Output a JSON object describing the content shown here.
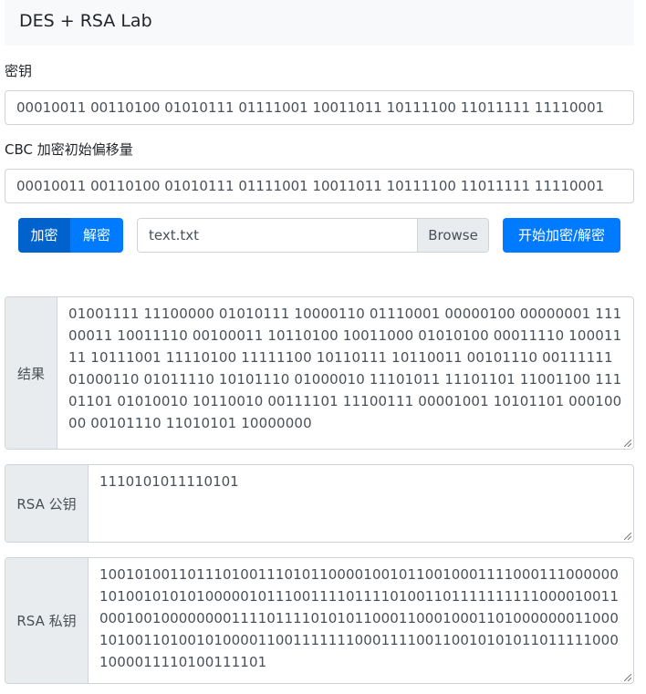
{
  "navbar": {
    "title": "DES + RSA Lab"
  },
  "key": {
    "label": "密钥",
    "value": "00010011 00110100 01010111 01111001 10011011 10111100 11011111 11110001"
  },
  "iv": {
    "label": "CBC 加密初始偏移量",
    "value": "00010011 00110100 01010111 01111001 10011011 10111100 11011111 11110001"
  },
  "mode": {
    "encrypt_label": "加密",
    "decrypt_label": "解密",
    "selected": "加密"
  },
  "file": {
    "name": "text.txt",
    "browse_label": "Browse"
  },
  "start_button": {
    "label": "开始加密/解密"
  },
  "result": {
    "label": "结果",
    "value": "01001111 11100000 01010111 10000110 01110001 00000100 00000001 11100011 10011110 00100011 10110100 10011000 01010100 00011110 10001111 10111001 11110100 11111100 10110111 10110011 00101110 00111111 01000110 01011110 10101110 01000010 11101011 11101101 11001100 11101101 01010010 10110010 00111101 11100111 00001001 10101101 00010000 00101110 11010101 10000000"
  },
  "rsa_public": {
    "label": "RSA 公钥",
    "value": "1110101011110101"
  },
  "rsa_private": {
    "label": "RSA 私钥",
    "value": "100101001101110100111010110000100101100100011110001110000001010010101010000010111001111011110100110111111111100001001100010010000000011110111101010110001100010001101000000011000101001101001010000110011111110001111001100101010110111110001000011110100111101"
  },
  "colors": {
    "primary": "#007bff",
    "primary_active": "#0062cc",
    "addon_bg": "#e9ecef",
    "border": "#ced4da",
    "navbar_bg": "#f8f9fa"
  }
}
